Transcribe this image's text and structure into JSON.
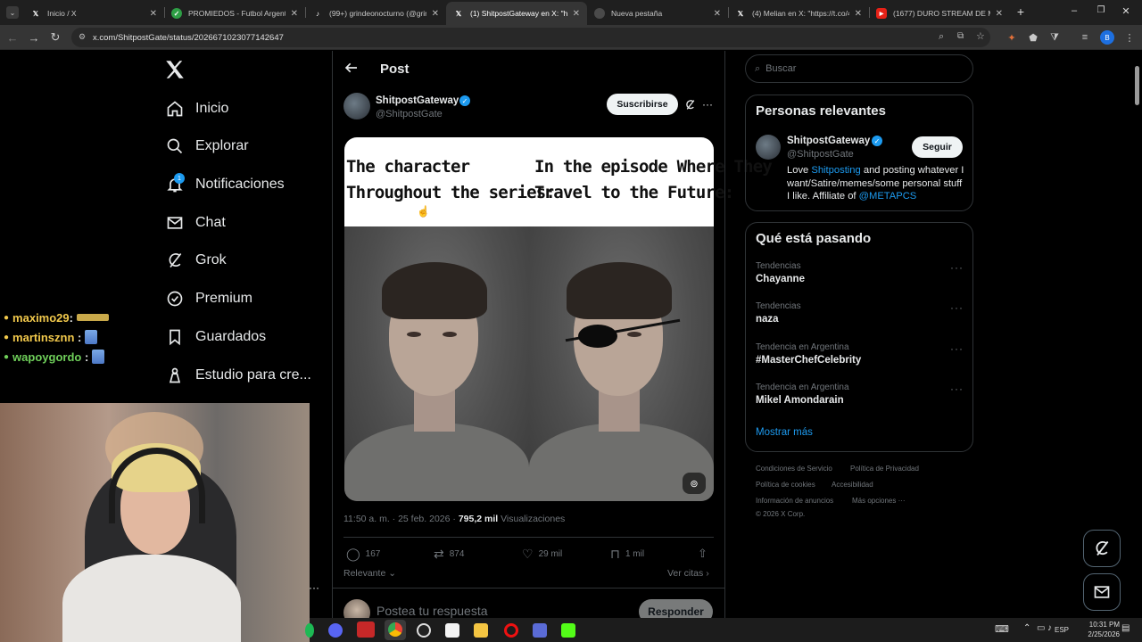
{
  "browser": {
    "tabs": [
      {
        "title": "Inicio / X",
        "icon": "x-logo-icon"
      },
      {
        "title": "PROMIEDOS - Futbol Argentino",
        "icon": "promiedos-icon"
      },
      {
        "title": "(99+) grindeonocturno (@grind",
        "icon": "tiktok-icon"
      },
      {
        "title": "(1) ShitpostGateway en X: \"http",
        "icon": "x-logo-icon"
      },
      {
        "title": "Nueva pestaña",
        "icon": "chrome-icon"
      },
      {
        "title": "(4) Melian en X: \"https://t.co/4",
        "icon": "x-logo-icon"
      },
      {
        "title": "(1677) DURO STREAM DE MEL",
        "icon": "youtube-icon"
      }
    ],
    "url": "x.com/ShitpostGate/status/2026671023077142647",
    "profile_letter": "B"
  },
  "nav": {
    "items": [
      {
        "label": "Inicio",
        "icon": "home-icon"
      },
      {
        "label": "Explorar",
        "icon": "search-icon"
      },
      {
        "label": "Notificaciones",
        "icon": "bell-icon"
      },
      {
        "label": "Chat",
        "icon": "mail-icon"
      },
      {
        "label": "Grok",
        "icon": "grok-icon"
      },
      {
        "label": "Premium",
        "icon": "verified-icon"
      },
      {
        "label": "Guardados",
        "icon": "bookmark-icon"
      },
      {
        "label": "Estudio para cre...",
        "icon": "studio-icon"
      }
    ],
    "notif_count": "1"
  },
  "post": {
    "header": "Post",
    "author_name": "ShitpostGateway",
    "author_handle": "@ShitpostGate",
    "subscribe_label": "Suscribirse",
    "caption_left": "The character\nThroughout the series:",
    "caption_right": "In the episode Where They\nTravel to the Future:",
    "time": "11:50 a. m. · 25 feb. 2026 · ",
    "views_count": "795,2 mil",
    "views_label": " Visualizaciones",
    "replies": "167",
    "reposts": "874",
    "likes": "29 mil",
    "bookmarks": "1 mil",
    "sort_label": "Relevante",
    "quotes_label": "Ver citas",
    "reply_placeholder": "Postea tu respuesta",
    "reply_button": "Responder"
  },
  "sidebar": {
    "search_placeholder": "Buscar",
    "relevant_title": "Personas relevantes",
    "person": {
      "name": "ShitpostGateway",
      "handle": "@ShitpostGate",
      "follow_label": "Seguir",
      "bio_1": "Love ",
      "bio_link": "Shitposting",
      "bio_2": " and posting whatever I want/Satire/memes/some personal stuff I like. Affiliate of ",
      "bio_mention": "@METAPCS"
    },
    "trends_title": "Qué está pasando",
    "trends": [
      {
        "context": "Tendencias",
        "name": "Chayanne"
      },
      {
        "context": "Tendencias",
        "name": "naza"
      },
      {
        "context": "Tendencia en Argentina",
        "name": "#MasterChefCelebrity"
      },
      {
        "context": "Tendencia en Argentina",
        "name": "Mikel Amondarain"
      }
    ],
    "show_more": "Mostrar más",
    "footer": [
      "Condiciones de Servicio",
      "Política de Privacidad",
      "Política de cookies",
      "Accesibilidad",
      "Información de anuncios",
      "Más opciones ···",
      "© 2026 X Corp."
    ]
  },
  "stream_chat": [
    {
      "user": "maximo29",
      "color": "#f2c94c"
    },
    {
      "user": "martinsznn",
      "color": "#f2c94c"
    },
    {
      "user": "wapoygordo",
      "color": "#6fcf5a"
    }
  ],
  "taskbar": {
    "lang": "ESP",
    "time": "10:31 PM",
    "date": "2/25/2026"
  },
  "colors": {
    "x_blue": "#1d9bf0",
    "bg": "#000000",
    "border": "#2f3336",
    "muted": "#71767b"
  }
}
